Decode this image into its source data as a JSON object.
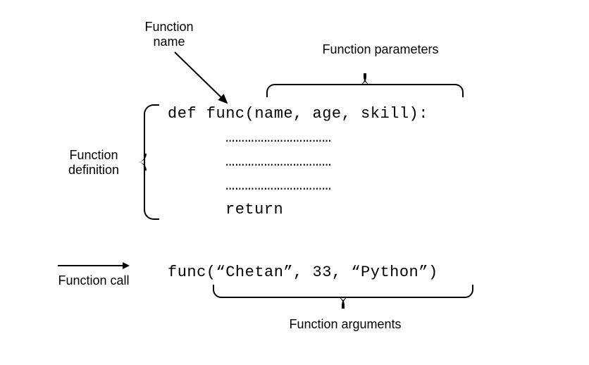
{
  "labels": {
    "function_name": "Function\nname",
    "function_parameters": "Function parameters",
    "function_definition": "Function\ndefinition",
    "function_call": "Function call",
    "function_arguments": "Function arguments"
  },
  "code": {
    "def_line": "def func(name, age, skill):",
    "body_placeholder": "……………………………",
    "return_kw": "return",
    "call_line": "func(“Chetan”, 33, “Python”)"
  }
}
